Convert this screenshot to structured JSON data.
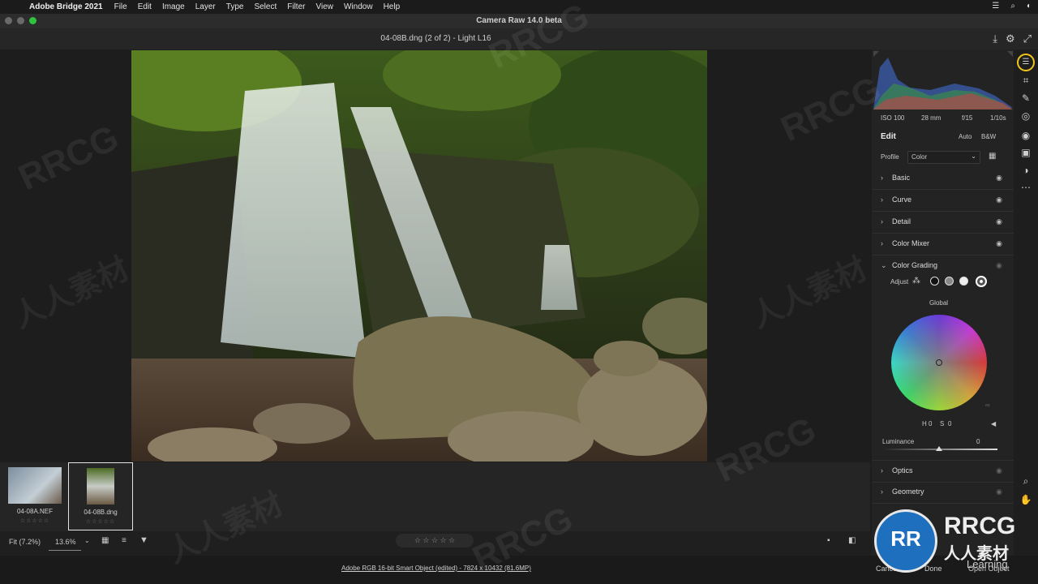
{
  "menubar": {
    "app_name": "Adobe Bridge 2021",
    "items": [
      "File",
      "Edit",
      "Image",
      "Layer",
      "Type",
      "Select",
      "Filter",
      "View",
      "Window",
      "Help"
    ]
  },
  "window": {
    "title": "Camera Raw 14.0 beta"
  },
  "subheader": {
    "filename": "04-08B.dng (2 of 2)  -  Light L16"
  },
  "histogram_info": {
    "iso": "ISO 100",
    "focal": "28 mm",
    "aperture": "f/15",
    "shutter": "1/10s"
  },
  "edit": {
    "title": "Edit",
    "auto_label": "Auto",
    "bw_label": "B&W",
    "profile_label": "Profile",
    "profile_value": "Color"
  },
  "sections": {
    "basic": "Basic",
    "curve": "Curve",
    "detail": "Detail",
    "color_mixer": "Color Mixer",
    "color_grading": "Color Grading",
    "optics": "Optics",
    "geometry": "Geometry"
  },
  "color_grading": {
    "adjust_label": "Adjust",
    "global_label": "Global",
    "h_label": "H",
    "h_value": "0",
    "s_label": "S",
    "s_value": "0",
    "luminance_label": "Luminance",
    "luminance_value": "0"
  },
  "filmstrip": {
    "items": [
      {
        "name": "04-08A.NEF",
        "stars": "☆☆☆☆☆"
      },
      {
        "name": "04-08B.dng",
        "stars": "☆☆☆☆☆"
      }
    ]
  },
  "bottombar": {
    "fit_label": "Fit (7.2%)",
    "zoom_value": "13.6%",
    "rating": "☆ ☆ ☆ ☆ ☆"
  },
  "status": {
    "info": "Adobe RGB 16-bit Smart Object (edited) - 7824 x 10432 (81.6MP)",
    "cancel_label": "Cancel",
    "done_label": "Done",
    "open_label": "Open Object"
  },
  "watermark": {
    "brand": "RRCG",
    "cn": "人人素材",
    "tagline": "Learning"
  },
  "colors": {
    "background": "#1d1d1d",
    "panel": "#232323",
    "accent_ring": "#f0c419"
  }
}
